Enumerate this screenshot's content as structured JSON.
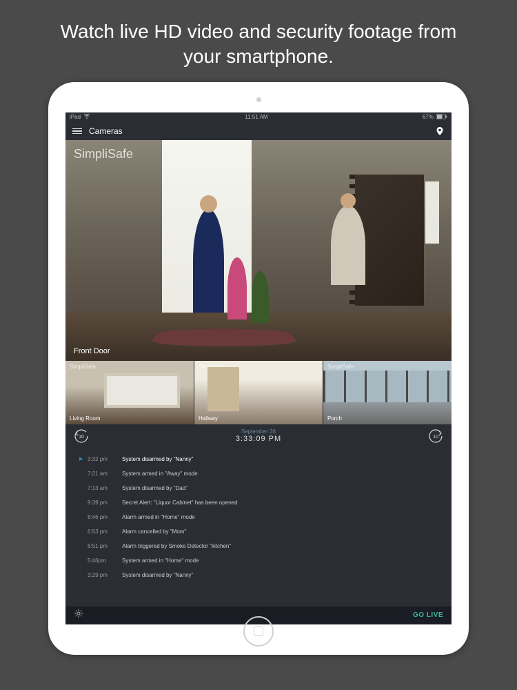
{
  "headline": "Watch live HD video and security footage from your smartphone.",
  "statusBar": {
    "device": "iPad",
    "time": "11:51 AM",
    "battery": "67%"
  },
  "nav": {
    "title": "Cameras"
  },
  "brand": "SimpliSafe",
  "mainCamera": {
    "label": "Front Door"
  },
  "thumbs": [
    {
      "label": "Living Room"
    },
    {
      "label": "Hallway"
    },
    {
      "label": "Porch"
    }
  ],
  "timeline": {
    "date": "September 26",
    "time": "3:33:09 PM",
    "skip": "10"
  },
  "events": [
    {
      "time": "3:32 pm",
      "msg": "System disarmed by \"Nanny\"",
      "active": true
    },
    {
      "time": "7:21 am",
      "msg": "System armed in \"Away\" mode"
    },
    {
      "time": "7:13 am",
      "msg": "System disarmed by \"Dad\""
    },
    {
      "time": "9:39 pm",
      "msg": "Secret Alert: \"Liquor Cabinet\" has been opened"
    },
    {
      "time": "8:46 pm",
      "msg": "Alarm armed in \"Home\" mode"
    },
    {
      "time": "6:53 pm",
      "msg": "Alarm cancelled by \"Mom\""
    },
    {
      "time": "6:51 pm",
      "msg": "Alarm triggered by Smoke Detector \"kitchen\""
    },
    {
      "time": "5:46pm",
      "msg": "System armed in \"Home\" mode"
    },
    {
      "time": "3:29 pm",
      "msg": "System disarmed by \"Nanny\""
    }
  ],
  "bottom": {
    "goLive": "GO LIVE"
  }
}
